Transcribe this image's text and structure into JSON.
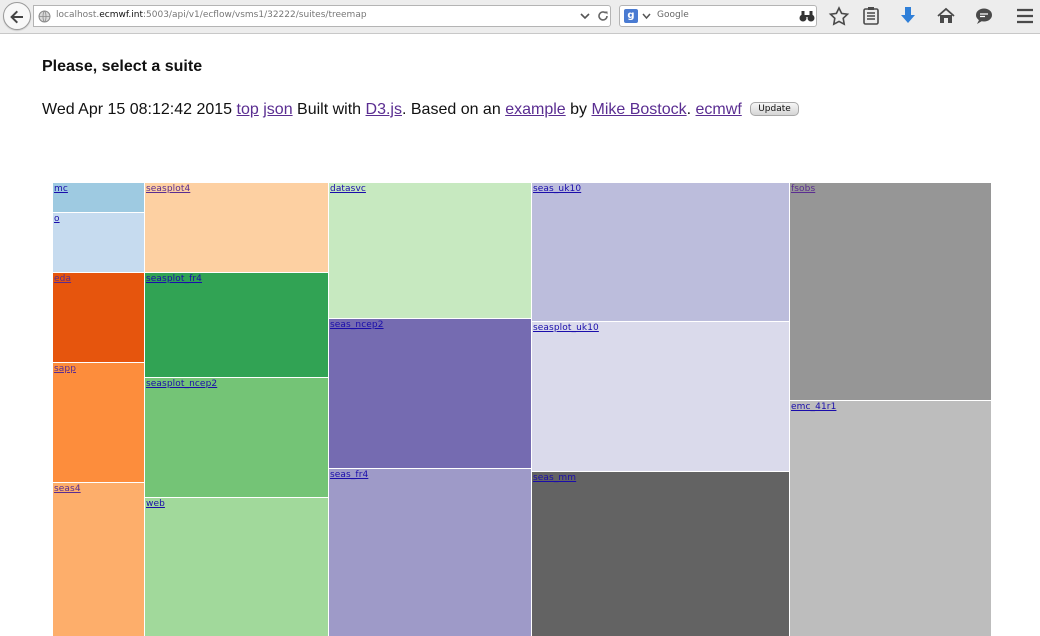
{
  "browser": {
    "url_prefix": "localhost.",
    "url_host": "ecmwf.int",
    "url_suffix": ":5003/api/v1/ecflow/vsms1/32222/suites/treemap",
    "search_engine_icon": "g",
    "search_placeholder": "Google",
    "icons": [
      "back-arrow-icon",
      "globe-icon",
      "dropdown-icon",
      "reload-icon",
      "search-engine-icon",
      "binoculars-icon",
      "bookmark-star-icon",
      "reading-list-icon",
      "download-icon",
      "home-icon",
      "chat-icon",
      "menu-icon"
    ]
  },
  "page": {
    "title": "Please, select a suite",
    "timestamp": "Wed Apr 15 08:12:42 2015",
    "link_top": "top",
    "link_json": "json",
    "built_with_text": "Built with",
    "link_d3": "D3.js",
    "based_on_text": ". Based on an",
    "link_example": "example",
    "by_text": "by",
    "link_author": "Mike Bostock",
    "dot_text": ".",
    "link_ecmwf": "ecmwf",
    "update_label": "Update"
  },
  "treemap": {
    "colors": {
      "blue_mid": "#9ecae1",
      "blue_light": "#c6dbef",
      "orange_dark": "#e6550d",
      "orange_mid": "#fd8d3c",
      "orange_light": "#fdae6b",
      "orange_pale": "#fdd0a2",
      "green_dark": "#31a354",
      "green_mid": "#74c476",
      "green_light": "#a1d99b",
      "green_pale": "#c7e9c0",
      "purple_dark": "#756bb1",
      "purple_mid": "#9e9ac8",
      "purple_light": "#bcbddc",
      "purple_pale": "#dadaeb",
      "gray_dark": "#636363",
      "gray_mid": "#969696",
      "gray_light": "#bdbdbd",
      "link_blue": "#1a0dab",
      "link_purple": "#5a2d91"
    },
    "cells": [
      {
        "name": "mc"
      },
      {
        "name": "o"
      },
      {
        "name": "eda"
      },
      {
        "name": "sapp"
      },
      {
        "name": "seas4"
      },
      {
        "name": "seasplot4"
      },
      {
        "name": "seasplot_fr4"
      },
      {
        "name": "seasplot_ncep2"
      },
      {
        "name": "web"
      },
      {
        "name": "datasvc"
      },
      {
        "name": "seas_ncep2"
      },
      {
        "name": "seas_fr4"
      },
      {
        "name": "seas_uk10"
      },
      {
        "name": "seasplot_uk10"
      },
      {
        "name": "seas_mm"
      },
      {
        "name": "fsobs"
      },
      {
        "name": "emc_41r1"
      }
    ]
  }
}
